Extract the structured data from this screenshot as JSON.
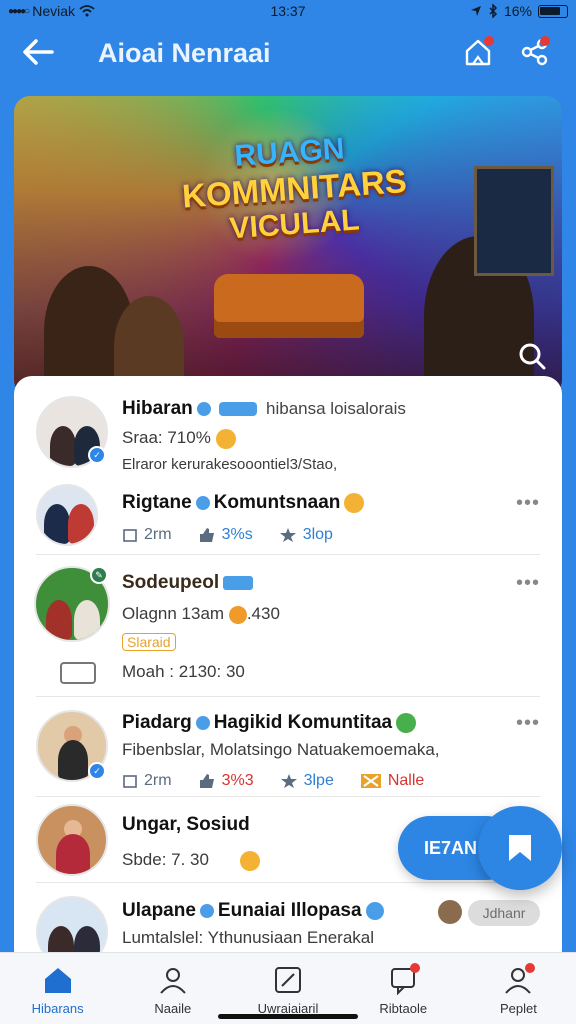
{
  "status": {
    "carrier": "Neviak",
    "time": "13:37",
    "battery": "16%"
  },
  "header": {
    "title": "Aioai Nenraai"
  },
  "banner": {
    "line1": "RUAGN",
    "line2": "KOMMNITARS",
    "line3": "VICULAL"
  },
  "feed": [
    {
      "title": "Hibaran",
      "title_extra": "hibansa loisalorais",
      "line1": "Sraa:  710%",
      "line2": "Elraror kerurakesooontiel3/Stao,"
    },
    {
      "title": "Rigtane",
      "title_suffix": "Komuntsnaan",
      "meta": [
        "2rm",
        "3%s",
        "3lop"
      ]
    },
    {
      "title": "Sodeupeol",
      "line1": "Olagnn  13am",
      "line1_value": ".430",
      "tag": "Slaraid",
      "line2": "Moah : 2130:  30"
    },
    {
      "title": "Piadarg",
      "title_suffix": "Hagikid Komuntitaa",
      "line1": "Fibenbslar, Molatsingo Natuakemoemaka,",
      "meta": [
        "2rm",
        "3%3",
        "3lpe",
        "Nalle"
      ]
    },
    {
      "title": "Ungar, Sosiud",
      "line1": "Sbde:   7. 30"
    },
    {
      "title": "Ulapane",
      "title_suffix": "Eunaiai Illopasa",
      "line1": "Lumtalslel: Ythunusiaan Enerakal",
      "pill": "Jdhanr"
    }
  ],
  "fab": {
    "label": "IE7AN"
  },
  "tabs": [
    "Hibarans",
    "Naaile",
    "Uwraiaiaril",
    "Ribtaole",
    "Peplet"
  ],
  "colors": {
    "primary": "#2f86e6",
    "accent_red": "#e53935",
    "tag_orange": "#e8a12b"
  }
}
